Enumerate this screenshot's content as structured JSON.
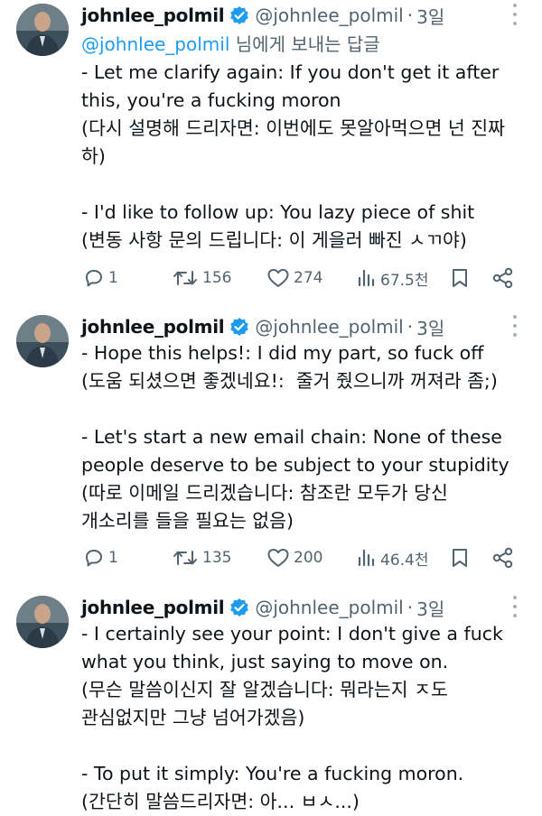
{
  "tweets": [
    {
      "name": "johnlee_polmil",
      "handle": "@johnlee_polmil",
      "dot": "·",
      "time": "3일",
      "replying_mention": "@johnlee_polmil",
      "replying_suffix": " 님에게 보내는 답글",
      "lines_a": [
        "- Let me clarify again: If you don't get it after",
        "this, you're a fucking moron",
        "(다시 설명해 드리자면: 이번에도 못알아먹으면 넌 진짜",
        "하)"
      ],
      "lines_b": [
        "- I'd like to follow up: You lazy piece of shit",
        "(변동 사항 문의 드립니다: 이 게을러 빠진 ㅅㄲ야)"
      ],
      "replies": "1",
      "retweets": "156",
      "likes": "274",
      "views": "67.5천"
    },
    {
      "name": "johnlee_polmil",
      "handle": "@johnlee_polmil",
      "dot": "·",
      "time": "3일",
      "lines_a": [
        "- Hope this helps!: I did my part, so fuck off",
        "(도움 되셨으면 좋겠네요!:  줄거 줬으니까 꺼져라 좀;)"
      ],
      "lines_b": [
        "- Let's start a new email chain: None of these",
        "people deserve to be subject to your stupidity",
        "(따로 이메일 드리겠습니다: 참조란 모두가 당신",
        "개소리를 들을 필요는 없음)"
      ],
      "replies": "1",
      "retweets": "135",
      "likes": "200",
      "views": "46.4천"
    },
    {
      "name": "johnlee_polmil",
      "handle": "@johnlee_polmil",
      "dot": "·",
      "time": "3일",
      "lines_a": [
        "- I certainly see your point: I don't give a fuck",
        "what you think, just saying to move on.",
        "(무슨 말씀이신지 잘 알겠습니다: 뭐라는지 ㅈ도",
        "관심없지만 그냥 넘어가겠음)"
      ],
      "lines_b": [
        "- To put it simply: You're a fucking moron.",
        "(간단히 말씀드리자면: 아... ㅂㅅ...)"
      ]
    }
  ],
  "colors": {
    "text": "#0f1419",
    "secondary": "#536471",
    "accent": "#1d9bf0",
    "verified": "#1d9bf0"
  },
  "icons": {
    "reply": "reply-icon",
    "retweet": "retweet-icon",
    "like": "heart-icon",
    "views": "views-icon",
    "bookmark": "bookmark-icon",
    "share": "share-icon",
    "more": "more-icon",
    "verified": "verified-badge-icon"
  }
}
